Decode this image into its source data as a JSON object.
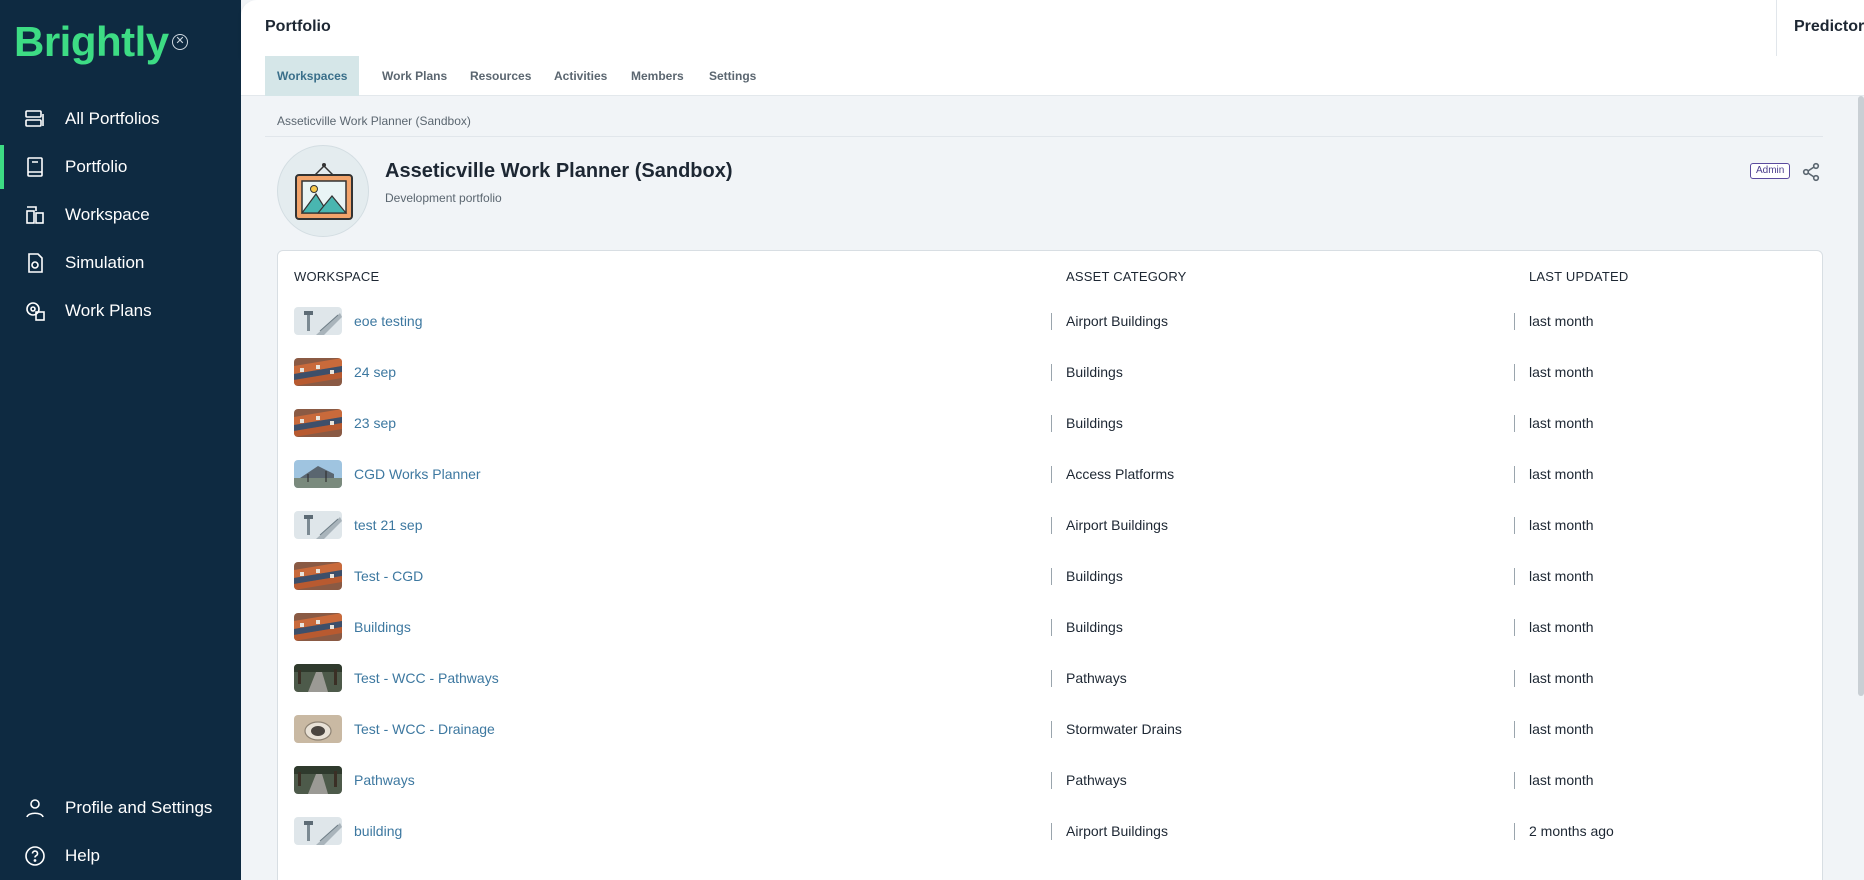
{
  "app": {
    "logo": "Brightly"
  },
  "sidebar": {
    "items": [
      {
        "label": "All Portfolios",
        "icon": "portfolios-icon"
      },
      {
        "label": "Portfolio",
        "icon": "book-icon",
        "active": true
      },
      {
        "label": "Workspace",
        "icon": "workspace-icon"
      },
      {
        "label": "Simulation",
        "icon": "simulation-icon"
      },
      {
        "label": "Work Plans",
        "icon": "work-plans-icon"
      }
    ],
    "bottom": [
      {
        "label": "Profile and Settings",
        "icon": "user-icon"
      },
      {
        "label": "Help",
        "icon": "help-icon"
      }
    ]
  },
  "topbar": {
    "title": "Portfolio",
    "right": "Predictor"
  },
  "tabs": [
    "Workspaces",
    "Work Plans",
    "Resources",
    "Activities",
    "Members",
    "Settings"
  ],
  "breadcrumb": "Asseticville Work Planner (Sandbox)",
  "portfolio": {
    "title": "Asseticville Work Planner (Sandbox)",
    "subtitle": "Development portfolio",
    "badge": "Admin"
  },
  "table": {
    "headers": [
      "WORKSPACE",
      "ASSET CATEGORY",
      "LAST UPDATED"
    ],
    "rows": [
      {
        "name": "eoe testing",
        "category": "Airport Buildings",
        "updated": "last month",
        "thumb": "airport"
      },
      {
        "name": "24 sep",
        "category": "Buildings",
        "updated": "last month",
        "thumb": "buildings"
      },
      {
        "name": "23 sep",
        "category": "Buildings",
        "updated": "last month",
        "thumb": "buildings"
      },
      {
        "name": "CGD Works Planner",
        "category": "Access Platforms",
        "updated": "last month",
        "thumb": "platform"
      },
      {
        "name": "test 21 sep",
        "category": "Airport Buildings",
        "updated": "last month",
        "thumb": "airport"
      },
      {
        "name": "Test - CGD",
        "category": "Buildings",
        "updated": "last month",
        "thumb": "buildings"
      },
      {
        "name": "Buildings",
        "category": "Buildings",
        "updated": "last month",
        "thumb": "buildings"
      },
      {
        "name": "Test - WCC - Pathways",
        "category": "Pathways",
        "updated": "last month",
        "thumb": "pathway"
      },
      {
        "name": "Test - WCC - Drainage",
        "category": "Stormwater Drains",
        "updated": "last month",
        "thumb": "drain"
      },
      {
        "name": "Pathways",
        "category": "Pathways",
        "updated": "last month",
        "thumb": "pathway"
      },
      {
        "name": "building",
        "category": "Airport Buildings",
        "updated": "2 months ago",
        "thumb": "airport"
      }
    ]
  }
}
